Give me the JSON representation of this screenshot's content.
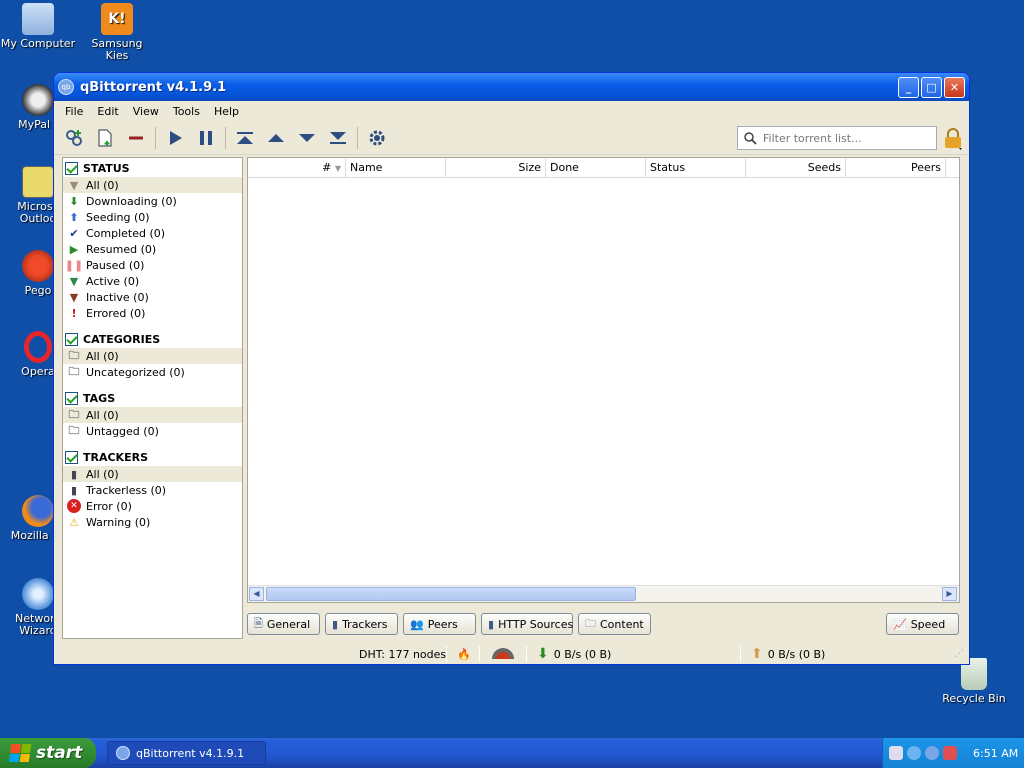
{
  "desktop": {
    "icons": [
      {
        "label": "My Computer"
      },
      {
        "label": "Samsung Kies"
      },
      {
        "label": "MyPal t"
      },
      {
        "label": "Microsc Outloo"
      },
      {
        "label": "Pego"
      },
      {
        "label": "Opera"
      },
      {
        "label": "Mozilla Fir"
      },
      {
        "label": "Network Wizard"
      },
      {
        "label": "Recycle Bin"
      }
    ]
  },
  "window": {
    "title": "qBittorrent v4.1.9.1",
    "controls": {
      "minimize": "_",
      "maximize": "□",
      "close": "✕"
    }
  },
  "menu": [
    "File",
    "Edit",
    "View",
    "Tools",
    "Help"
  ],
  "toolbar": {
    "search_placeholder": "Filter torrent list..."
  },
  "sidebar": {
    "status": {
      "header": "STATUS",
      "items": [
        {
          "label": "All (0)",
          "icon": "funnel-icon"
        },
        {
          "label": "Downloading (0)",
          "icon": "download-arrow-icon"
        },
        {
          "label": "Seeding (0)",
          "icon": "upload-arrow-icon"
        },
        {
          "label": "Completed (0)",
          "icon": "checkmark-icon"
        },
        {
          "label": "Resumed (0)",
          "icon": "play-icon"
        },
        {
          "label": "Paused (0)",
          "icon": "pause-icon"
        },
        {
          "label": "Active (0)",
          "icon": "funnel-icon"
        },
        {
          "label": "Inactive (0)",
          "icon": "funnel-icon"
        },
        {
          "label": "Errored (0)",
          "icon": "exclamation-icon"
        }
      ]
    },
    "categories": {
      "header": "CATEGORIES",
      "items": [
        {
          "label": "All (0)"
        },
        {
          "label": "Uncategorized (0)"
        }
      ]
    },
    "tags": {
      "header": "TAGS",
      "items": [
        {
          "label": "All (0)"
        },
        {
          "label": "Untagged (0)"
        }
      ]
    },
    "trackers": {
      "header": "TRACKERS",
      "items": [
        {
          "label": "All (0)"
        },
        {
          "label": "Trackerless (0)"
        },
        {
          "label": "Error (0)"
        },
        {
          "label": "Warning (0)"
        }
      ]
    }
  },
  "list": {
    "columns": [
      "#",
      "Name",
      "Size",
      "Done",
      "Status",
      "Seeds",
      "Peers"
    ]
  },
  "tabs": [
    "General",
    "Trackers",
    "Peers",
    "HTTP Sources",
    "Content"
  ],
  "speed_button": "Speed",
  "statusbar": {
    "dht": "DHT: 177 nodes",
    "download": "0 B/s (0 B)",
    "upload": "0 B/s (0 B)"
  },
  "taskbar": {
    "start": "start",
    "task": "qBittorrent v4.1.9.1",
    "clock": "6:51 AM"
  },
  "colors": {
    "desktop": "#0f4fa8",
    "titlebar": "#0a5ee8",
    "start": "#2f8a2f"
  }
}
